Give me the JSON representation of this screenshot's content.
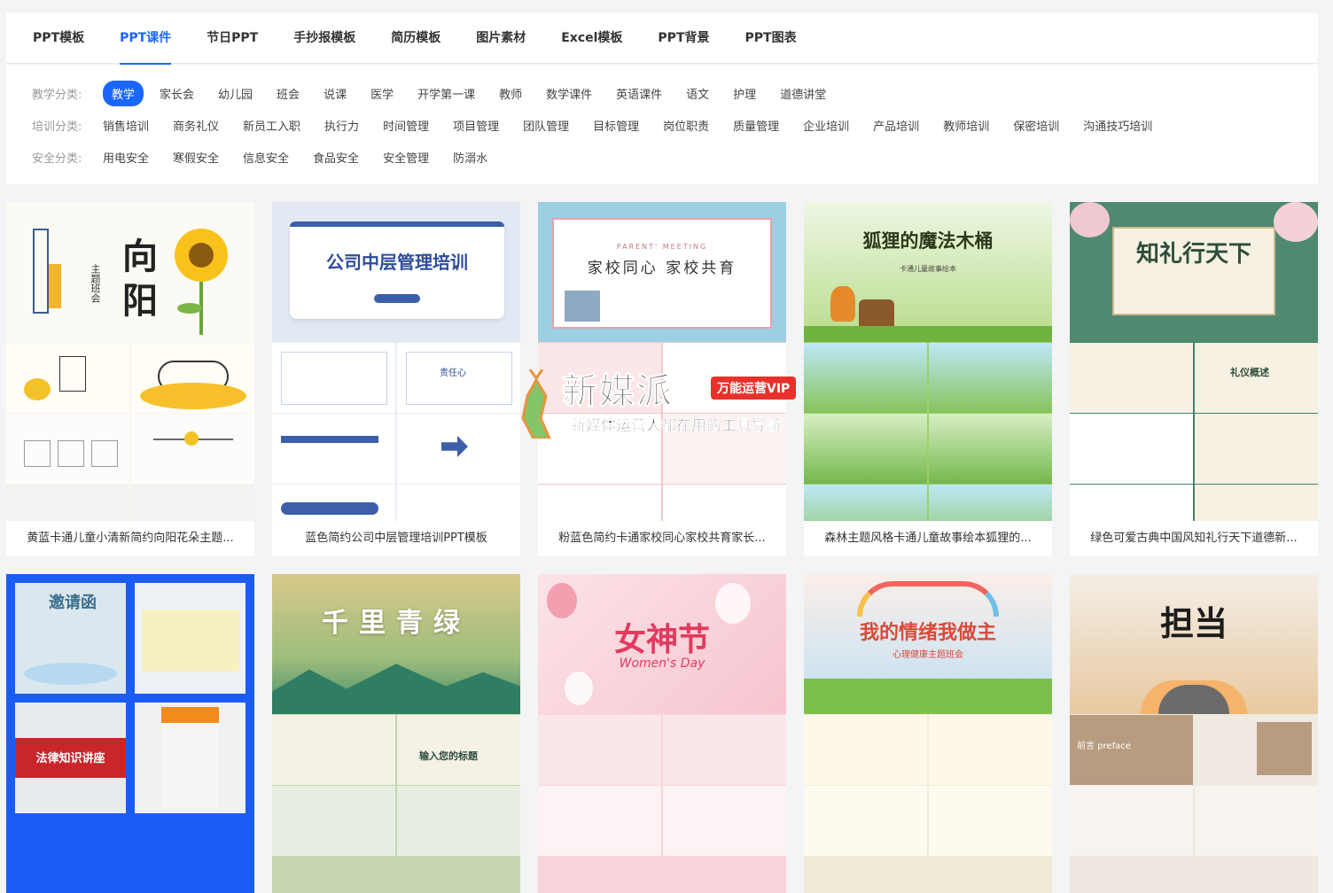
{
  "nav": {
    "tabs": [
      "PPT模板",
      "PPT课件",
      "节日PPT",
      "手抄报模板",
      "简历模板",
      "图片素材",
      "Excel模板",
      "PPT背景",
      "PPT图表"
    ],
    "active_tab": "PPT课件"
  },
  "filters": {
    "teaching": {
      "label": "教学分类:",
      "items": [
        "教学",
        "家长会",
        "幼儿园",
        "班会",
        "说课",
        "医学",
        "开学第一课",
        "教师",
        "数学课件",
        "英语课件",
        "语文",
        "护理",
        "道德讲堂"
      ],
      "active": "教学"
    },
    "training": {
      "label": "培训分类:",
      "items": [
        "销售培训",
        "商务礼仪",
        "新员工入职",
        "执行力",
        "时间管理",
        "项目管理",
        "团队管理",
        "目标管理",
        "岗位职责",
        "质量管理",
        "企业培训",
        "产品培训",
        "教师培训",
        "保密培训",
        "沟通技巧培训"
      ]
    },
    "safety": {
      "label": "安全分类:",
      "items": [
        "用电安全",
        "寒假安全",
        "信息安全",
        "食品安全",
        "安全管理",
        "防溺水"
      ]
    }
  },
  "cards": [
    {
      "title": "黄蓝卡通儿童小清新简约向阳花朵主题...",
      "cover_text": "向阳",
      "sub_text": "主题班会"
    },
    {
      "title": "蓝色简约公司中层管理培训PPT模板",
      "cover_text": "公司中层管理培训",
      "sub_text": "责任心"
    },
    {
      "title": "粉蓝色简约卡通家校同心家校共育家长...",
      "cover_text": "家校同心 家校共育",
      "sub_text": "PARENT' MEETING"
    },
    {
      "title": "森林主题风格卡通儿童故事绘本狐狸的...",
      "cover_text": "狐狸的魔法木桶",
      "sub_text": "卡通儿童故事绘本"
    },
    {
      "title": "绿色可爱古典中国风知礼行天下道德新...",
      "cover_text": "知礼行天下",
      "sub_text": "礼仪概述"
    },
    {
      "title": "",
      "cover_text": "邀请函",
      "sub_text": "法律知识讲座"
    },
    {
      "title": "",
      "cover_text": "千里青绿",
      "sub_text": "输入您的标题"
    },
    {
      "title": "",
      "cover_text": "女神节",
      "sub_text": "Women's Day"
    },
    {
      "title": "",
      "cover_text": "我的情绪我做主",
      "sub_text": "心理健康主题班会"
    },
    {
      "title": "",
      "cover_text": "担当",
      "sub_text": "前言 preface"
    }
  ],
  "watermark": {
    "brand": "新媒派",
    "badge": "万能运营VIP",
    "slogan": "新媒体运营人都在用的工具导航"
  },
  "colors": {
    "accent": "#1a66ff"
  }
}
